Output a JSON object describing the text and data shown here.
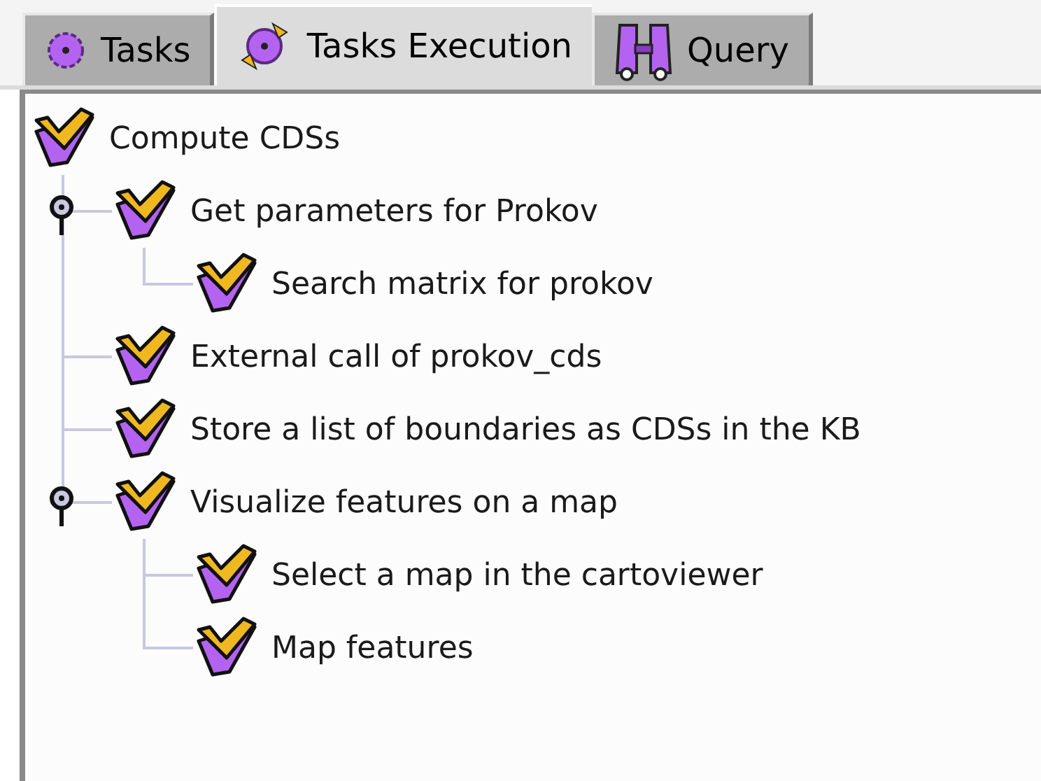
{
  "tabs": [
    {
      "label": "Tasks",
      "kind": "gear",
      "selected": false
    },
    {
      "label": "Tasks Execution",
      "kind": "cycle",
      "selected": true
    },
    {
      "label": "Query",
      "kind": "binoculars",
      "selected": false
    }
  ],
  "tree": {
    "label": "Compute CDSs",
    "children": [
      {
        "label": "Get parameters for Prokov",
        "expanded": true,
        "children": [
          {
            "label": "Search matrix for prokov"
          }
        ]
      },
      {
        "label": "External call of prokov_cds"
      },
      {
        "label": "Store a list of boundaries as CDSs in the KB"
      },
      {
        "label": "Visualize features on a map",
        "expanded": true,
        "children": [
          {
            "label": "Select a map in the cartoviewer"
          },
          {
            "label": "Map features"
          }
        ]
      }
    ]
  }
}
